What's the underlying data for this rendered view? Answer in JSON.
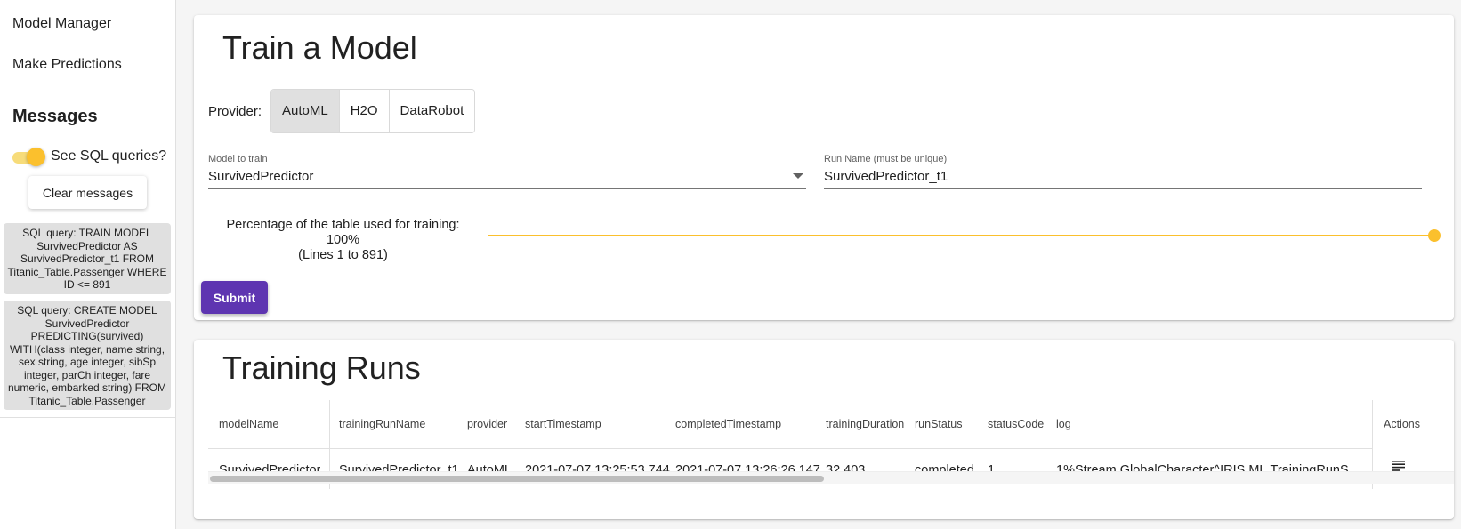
{
  "sidebar": {
    "nav": [
      {
        "label": "Model Manager"
      },
      {
        "label": "Make Predictions"
      }
    ],
    "messages_heading": "Messages",
    "toggle_label": "See SQL queries?",
    "toggle_on": true,
    "clear_label": "Clear messages",
    "messages": [
      {
        "text": "SQL query: TRAIN MODEL SurvivedPredictor AS SurvivedPredictor_t1 FROM Titanic_Table.Passenger WHERE ID <= 891"
      },
      {
        "text": "SQL query: CREATE MODEL SurvivedPredictor PREDICTING(survived) WITH(class integer, name string, sex string, age integer, sibSp integer, parCh integer, fare numeric, embarked string) FROM Titanic_Table.Passenger"
      }
    ]
  },
  "train": {
    "title": "Train a Model",
    "provider_label": "Provider:",
    "providers": [
      "AutoML",
      "H2O",
      "DataRobot"
    ],
    "selected_provider": "AutoML",
    "model_label": "Model to train",
    "model_value": "SurvivedPredictor",
    "run_label": "Run Name (must be unique)",
    "run_value": "SurvivedPredictor_t1",
    "pct_line1": "Percentage of the table used for training: 100%",
    "pct_line2": "(Lines 1 to 891)",
    "slider_value": 100,
    "submit_label": "Submit"
  },
  "runs": {
    "title": "Training Runs",
    "columns": [
      "modelName",
      "trainingRunName",
      "provider",
      "startTimestamp",
      "completedTimestamp",
      "trainingDuration",
      "runStatus",
      "statusCode",
      "log"
    ],
    "actions_label": "Actions",
    "rows": [
      [
        "SurvivedPredictor",
        "SurvivedPredictor_t1",
        "AutoML",
        "2021-07-07 13:25:53.744",
        "2021-07-07 13:26:26.147",
        "32.403",
        "completed",
        "1",
        "1%Stream.GlobalCharacter^IRIS.ML.TrainingRunS"
      ]
    ]
  },
  "colors": {
    "accent": "#fbc02d",
    "submit": "#5e35b1",
    "active_option": "#e0e0e0"
  }
}
